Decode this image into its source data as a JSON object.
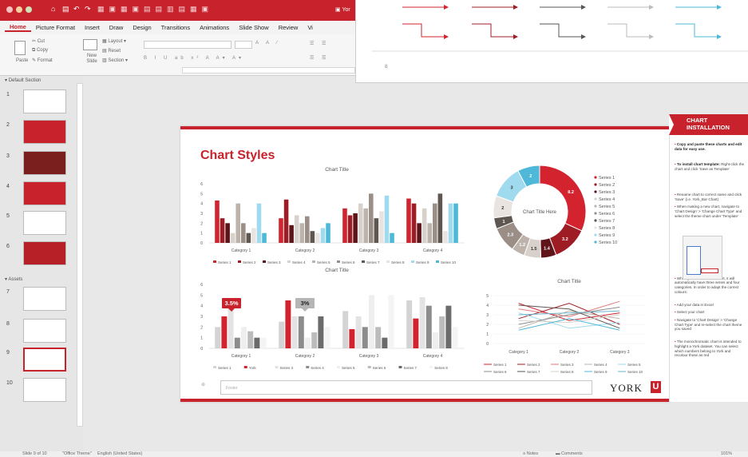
{
  "window": {
    "title": "Yor"
  },
  "ribbon": {
    "tabs": [
      "Home",
      "Picture Format",
      "Insert",
      "Draw",
      "Design",
      "Transitions",
      "Animations",
      "Slide Show",
      "Review",
      "Vi"
    ],
    "paste": "Paste",
    "cut": "Cut",
    "copy": "Copy",
    "format": "Format",
    "new_slide": "New Slide",
    "layout": "Layout",
    "reset": "Reset",
    "section": "Section"
  },
  "panel": {
    "default_section": "Default Section",
    "assets_section": "Assets",
    "slide_numbers": [
      "1",
      "2",
      "3",
      "4",
      "5",
      "6",
      "7",
      "8",
      "9",
      "10"
    ]
  },
  "popup": {
    "page_number": "8"
  },
  "slide": {
    "title": "Chart Styles",
    "footer_placeholder": "Footer",
    "logo": "YORK",
    "logo_mark": "U"
  },
  "sidebar": {
    "heading_line1": "CHART",
    "heading_line2": "INSTALLATION",
    "notes": [
      {
        "bold": "Copy and paste these charts and edit data for easy use.",
        "text": ""
      },
      {
        "bold": "To install chart template:",
        "text": "Right-click the chart and click 'Save as Template'"
      },
      {
        "bold": "",
        "text": "Rename chart to correct name and click 'Save' (i.e. York_Bar Chart)"
      },
      {
        "bold": "",
        "text": "When making a new chart, navigate to 'Chart Design' > 'Change Chart Type' and select the theme chart under 'Template'"
      },
      {
        "bold": "",
        "text": "When you create a new chart, it will automatically have three series and four categories. In order to adapt the correct colours:"
      },
      {
        "bold": "",
        "text": "Add your data in Excel"
      },
      {
        "bold": "",
        "text": "Select your chart"
      },
      {
        "bold": "",
        "text": "Navigate to 'Chart Design' > 'Change Chart Type' and re-select the chart theme you saved"
      },
      {
        "bold": "",
        "text": "The monochromatic chart is intended to highlight a York dataset. You can select which numbers belong to York and recolour those as red"
      }
    ]
  },
  "status": {
    "slide_info": "Slide 9 of 10",
    "theme": "\"Office Theme\"",
    "language": "English (United States)",
    "notes": "Notes",
    "comments": "Comments",
    "zoom": "101%"
  },
  "colors": {
    "brand": "#c8232c",
    "dark_red": "#8b1a1f",
    "grey": "#b4aca5",
    "dark_grey": "#5e5651",
    "teal": "#4fb8d8"
  },
  "chart_data": [
    {
      "type": "bar",
      "title": "Chart Title",
      "categories": [
        "Category 1",
        "Category 2",
        "Category 3",
        "Category 4"
      ],
      "yticks": [
        "0",
        "1",
        "2",
        "3",
        "4",
        "5",
        "6"
      ],
      "ylim": [
        0,
        6
      ],
      "series": [
        {
          "name": "Series 1",
          "color": "#d2232f",
          "values": [
            4.3,
            2.5,
            3.5,
            4.5
          ]
        },
        {
          "name": "Series 2",
          "color": "#9e1c24",
          "values": [
            2.5,
            4.4,
            2.8,
            4.0
          ]
        },
        {
          "name": "Series 3",
          "color": "#5e1418",
          "values": [
            2.0,
            1.8,
            3.0,
            2.0
          ]
        },
        {
          "name": "Series 4",
          "color": "#d8d0ca",
          "values": [
            1.0,
            2.8,
            4.0,
            3.5
          ]
        },
        {
          "name": "Series 5",
          "color": "#bdb3ab",
          "values": [
            4.0,
            2.0,
            3.5,
            2.0
          ]
        },
        {
          "name": "Series 6",
          "color": "#9a8e86",
          "values": [
            2.0,
            2.7,
            5.0,
            4.0
          ]
        },
        {
          "name": "Series 7",
          "color": "#5e5651",
          "values": [
            1.0,
            1.2,
            2.5,
            5.0
          ]
        },
        {
          "name": "Series 8",
          "color": "#e9e4e0",
          "values": [
            1.5,
            1.0,
            3.2,
            1.2
          ]
        },
        {
          "name": "Series 9",
          "color": "#9fdaee",
          "values": [
            4.0,
            1.5,
            4.8,
            4.0
          ]
        },
        {
          "name": "Series 10",
          "color": "#4fb8d8",
          "values": [
            1.0,
            2.0,
            1.0,
            4.0
          ]
        }
      ]
    },
    {
      "type": "pie",
      "title": "Chart Title Here",
      "slices": [
        {
          "name": "Series 1",
          "value": 8.2,
          "label": "8.2",
          "color": "#d2232f"
        },
        {
          "name": "Series 2",
          "value": 3.2,
          "label": "3.2",
          "color": "#9e1c24"
        },
        {
          "name": "Series 3",
          "value": 1.4,
          "label": "1.4",
          "color": "#5e1418"
        },
        {
          "name": "Series 4",
          "value": 1.5,
          "label": "1.5",
          "color": "#d8d0ca"
        },
        {
          "name": "Series 5",
          "value": 1.2,
          "label": "1.2",
          "color": "#bdb3ab"
        },
        {
          "name": "Series 6",
          "value": 2.3,
          "label": "2.3",
          "color": "#9a8e86"
        },
        {
          "name": "Series 7",
          "value": 1.0,
          "label": "1",
          "color": "#5e5651"
        },
        {
          "name": "Series 8",
          "value": 2.0,
          "label": "2",
          "color": "#e9e4e0"
        },
        {
          "name": "Series 9",
          "value": 3.0,
          "label": "3",
          "color": "#9fdaee"
        },
        {
          "name": "Series 10",
          "value": 2.0,
          "label": "2",
          "color": "#4fb8d8"
        }
      ]
    },
    {
      "type": "bar",
      "title": "Chart Title",
      "categories": [
        "Category 1",
        "Category 2",
        "Category 3",
        "Category 4"
      ],
      "yticks": [
        "0",
        "1",
        "2",
        "3",
        "4",
        "5",
        "6"
      ],
      "ylim": [
        0,
        6
      ],
      "callouts": [
        "3.5%",
        "3%"
      ],
      "series": [
        {
          "name": "Series 1",
          "color": "#d4d4d4",
          "values": [
            2.0,
            2.5,
            3.5,
            4.5
          ]
        },
        {
          "name": "York",
          "color": "#d2232f",
          "values": [
            3.0,
            4.5,
            1.8,
            2.8
          ]
        },
        {
          "name": "Series 3",
          "color": "#e3e3e3",
          "values": [
            4.0,
            3.0,
            3.0,
            4.8
          ]
        },
        {
          "name": "Series 4",
          "color": "#8c8c8c",
          "values": [
            1.0,
            3.0,
            2.0,
            4.0
          ]
        },
        {
          "name": "Series 5",
          "color": "#eeeeee",
          "values": [
            2.0,
            1.0,
            5.0,
            1.5
          ]
        },
        {
          "name": "Series 6",
          "color": "#bcbcbc",
          "values": [
            1.6,
            1.5,
            2.0,
            3.0
          ]
        },
        {
          "name": "Series 7",
          "color": "#6b6b6b",
          "values": [
            1.0,
            3.0,
            1.0,
            4.0
          ]
        },
        {
          "name": "Series 8",
          "color": "#f4f4f4",
          "values": [
            1.0,
            2.0,
            5.0,
            2.0
          ]
        }
      ]
    },
    {
      "type": "line",
      "title": "Chart Title",
      "categories": [
        "Category 1",
        "Category 2",
        "Category 3"
      ],
      "yticks": [
        "0",
        "1",
        "2",
        "3",
        "4",
        "5"
      ],
      "ylim": [
        0,
        5
      ],
      "series": [
        {
          "name": "Series 1",
          "color": "#d2232f",
          "values": [
            4.2,
            2.4,
            3.2
          ]
        },
        {
          "name": "Series 2",
          "color": "#9e1c24",
          "values": [
            2.6,
            4.2,
            2.0
          ]
        },
        {
          "name": "Series 3",
          "color": "#e57a7f",
          "values": [
            3.6,
            2.8,
            4.4
          ]
        },
        {
          "name": "Series 4",
          "color": "#bdb3ab",
          "values": [
            1.6,
            3.4,
            2.6
          ]
        },
        {
          "name": "Series 5",
          "color": "#9fdaee",
          "values": [
            3.2,
            1.6,
            2.2
          ]
        },
        {
          "name": "Series 6",
          "color": "#8c8c8c",
          "values": [
            2.0,
            3.0,
            3.8
          ]
        },
        {
          "name": "Series 7",
          "color": "#5e5651",
          "values": [
            4.0,
            3.6,
            1.6
          ]
        },
        {
          "name": "Series 8",
          "color": "#d8d0ca",
          "values": [
            2.4,
            2.2,
            3.0
          ]
        },
        {
          "name": "Series 9",
          "color": "#4fb8d8",
          "values": [
            1.4,
            2.6,
            1.4
          ]
        },
        {
          "name": "Series 10",
          "color": "#6bb7cc",
          "values": [
            3.0,
            3.2,
            3.4
          ]
        }
      ]
    }
  ]
}
